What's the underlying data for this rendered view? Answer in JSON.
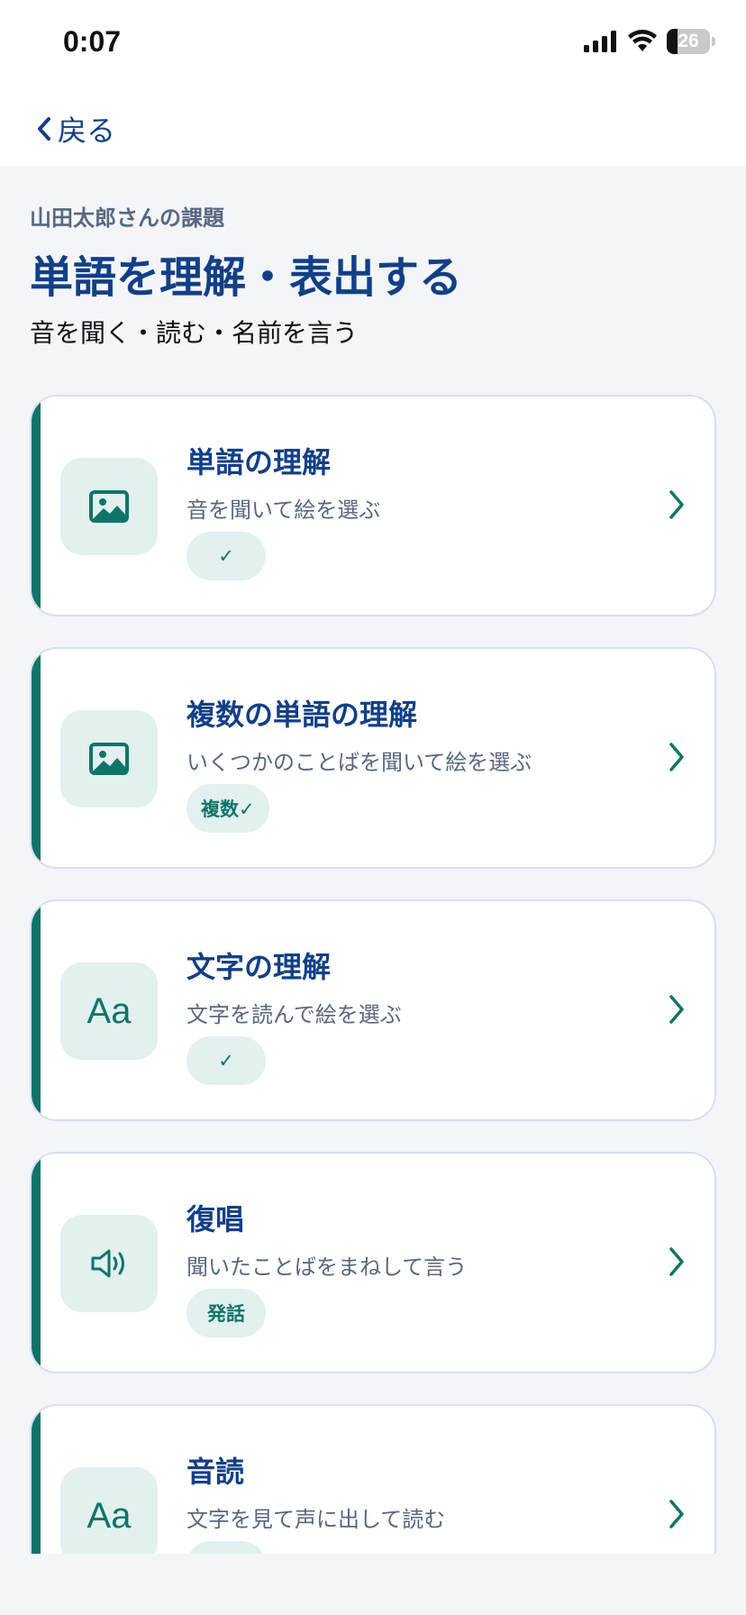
{
  "status": {
    "time": "0:07",
    "battery": "26",
    "battery_level": 0.26
  },
  "nav": {
    "back_label": "戻る"
  },
  "header": {
    "owner": "山田太郎さんの課題",
    "title": "単語を理解・表出する",
    "subtitle": "音を聞く・読む・名前を言う"
  },
  "colors": {
    "accent": "#0f7468",
    "title": "#123f86",
    "tile_bg": "#e2f0ef",
    "page_bg": "#f3f5f9"
  },
  "tasks": [
    {
      "title": "単語の理解",
      "description": "音を聞いて絵を選ぶ",
      "tag": "✓",
      "icon": "image-icon"
    },
    {
      "title": "複数の単語の理解",
      "description": "いくつかのことばを聞いて絵を選ぶ",
      "tag": "複数✓",
      "icon": "image-icon"
    },
    {
      "title": "文字の理解",
      "description": "文字を読んで絵を選ぶ",
      "tag": "✓",
      "icon": "text-aa-icon",
      "icon_text": "Aa"
    },
    {
      "title": "復唱",
      "description": "聞いたことばをまねして言う",
      "tag": "発話",
      "icon": "speaker-icon"
    },
    {
      "title": "音読",
      "description": "文字を見て声に出して読む",
      "tag": "",
      "icon": "text-aa-icon",
      "icon_text": "Aa"
    }
  ]
}
